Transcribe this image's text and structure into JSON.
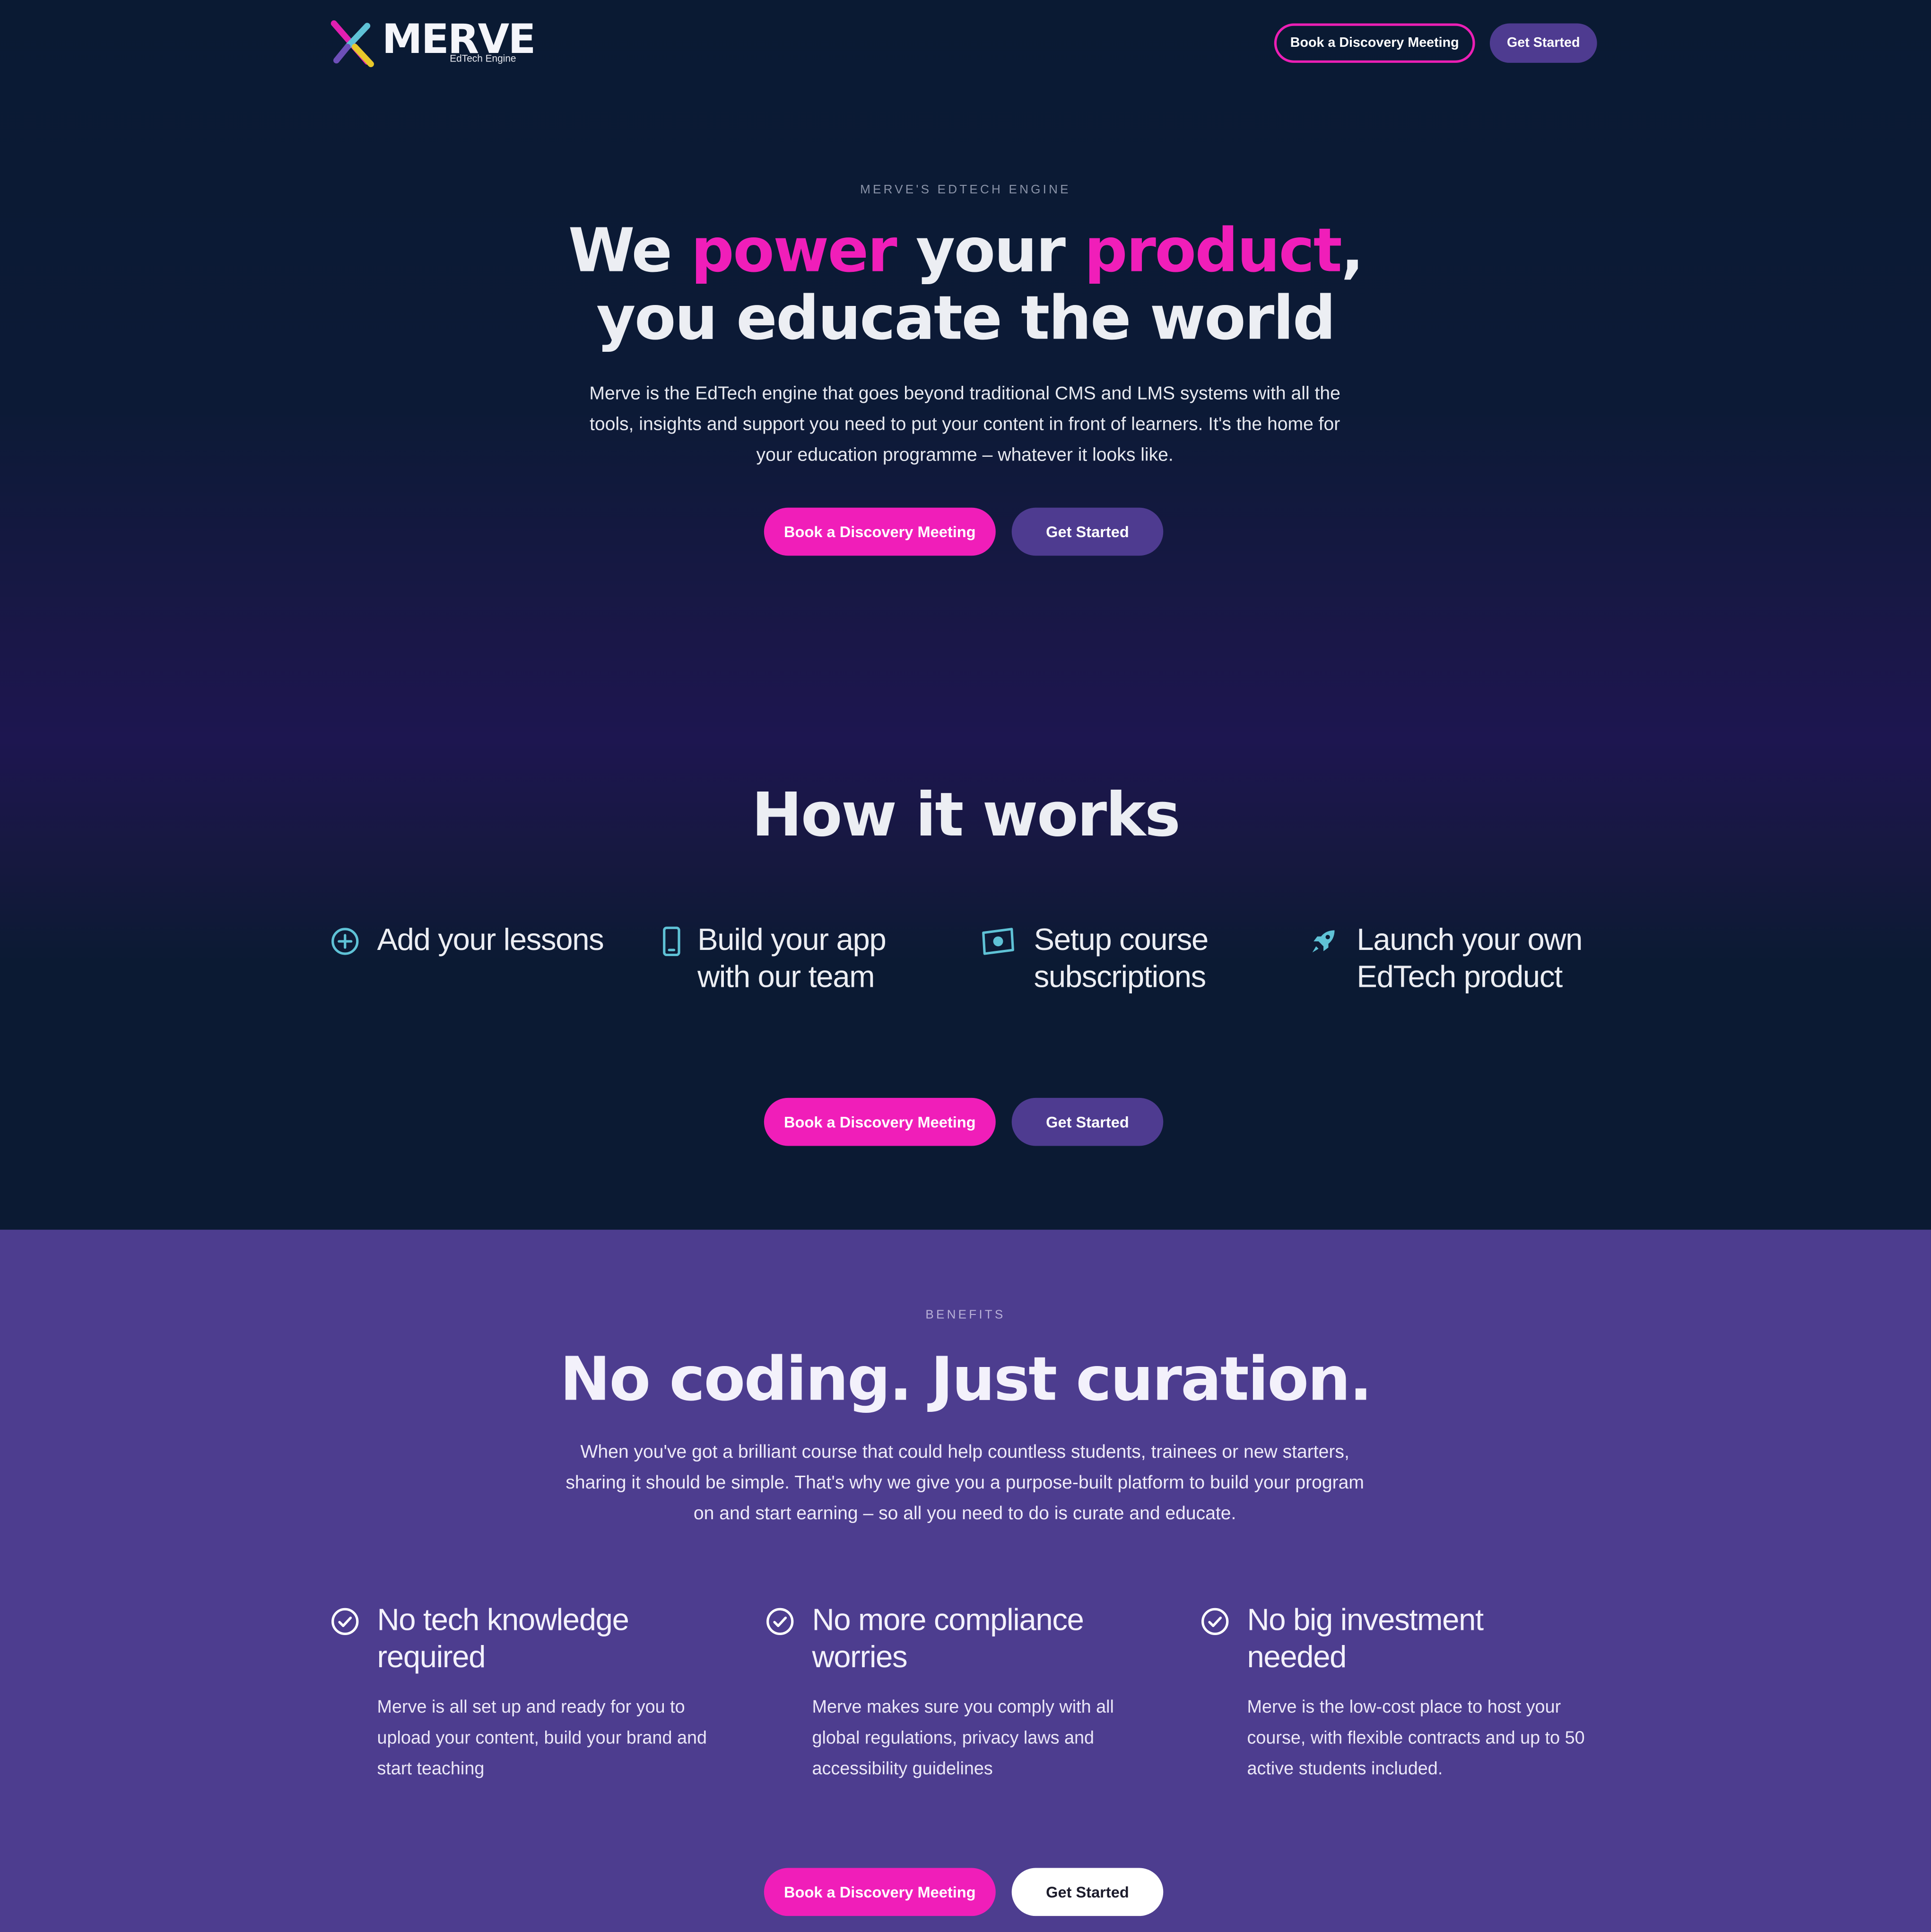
{
  "colors": {
    "pink": "#f01eb9",
    "purple": "#4e3b90",
    "navy": "#0b1a33",
    "benefits_bg": "#4d3d8f",
    "icon_teal": "#5fc2d6"
  },
  "header": {
    "logo_word": "MERVE",
    "logo_tagline": "EdTech Engine",
    "book_button": "Book a Discovery Meeting",
    "start_button": "Get Started"
  },
  "hero": {
    "eyebrow": "MERVE'S EDTECH ENGINE",
    "title_line1": {
      "w1": "We ",
      "w2": "power",
      "w3": " your ",
      "w4": "product",
      "w5": ","
    },
    "title_line2": "you educate the world",
    "text": "Merve is the EdTech engine that goes beyond traditional CMS and LMS systems with all the tools, insights and support you need to put your content in front of learners. It's the home for your education programme – whatever it looks like.",
    "book_button": "Book a Discovery Meeting",
    "start_button": "Get Started"
  },
  "how": {
    "title": "How it works",
    "steps": [
      {
        "icon": "plus-circle-icon",
        "label": "Add your lessons"
      },
      {
        "icon": "mobile-phone-icon",
        "label": "Build your app\nwith our team"
      },
      {
        "icon": "money-bill-icon",
        "label": "Setup course\nsubscriptions"
      },
      {
        "icon": "rocket-icon",
        "label": "Launch your own\nEdTech product"
      }
    ],
    "book_button": "Book a Discovery Meeting",
    "start_button": "Get Started"
  },
  "benefits": {
    "eyebrow": "BENEFITS",
    "title": "No coding. Just curation.",
    "text": "When you've got a brilliant course that could help countless students, trainees or new starters, sharing it should be simple. That's why we give you a purpose-built platform to build your program on and start earning – so all you need to do is curate and educate.",
    "items": [
      {
        "icon": "check-circle-icon",
        "title": "No tech knowledge required",
        "body": "Merve is all set up and ready for you to upload your content, build your brand and start teaching"
      },
      {
        "icon": "check-circle-icon",
        "title": "No more compliance worries",
        "body": "Merve makes sure you comply with all global regulations, privacy laws and accessibility guidelines"
      },
      {
        "icon": "check-circle-icon",
        "title": "No big investment needed",
        "body": "Merve is the low-cost place to host your course, with flexible contracts and up to 50 active students included."
      }
    ],
    "book_button": "Book a Discovery Meeting",
    "start_button": "Get Started"
  }
}
